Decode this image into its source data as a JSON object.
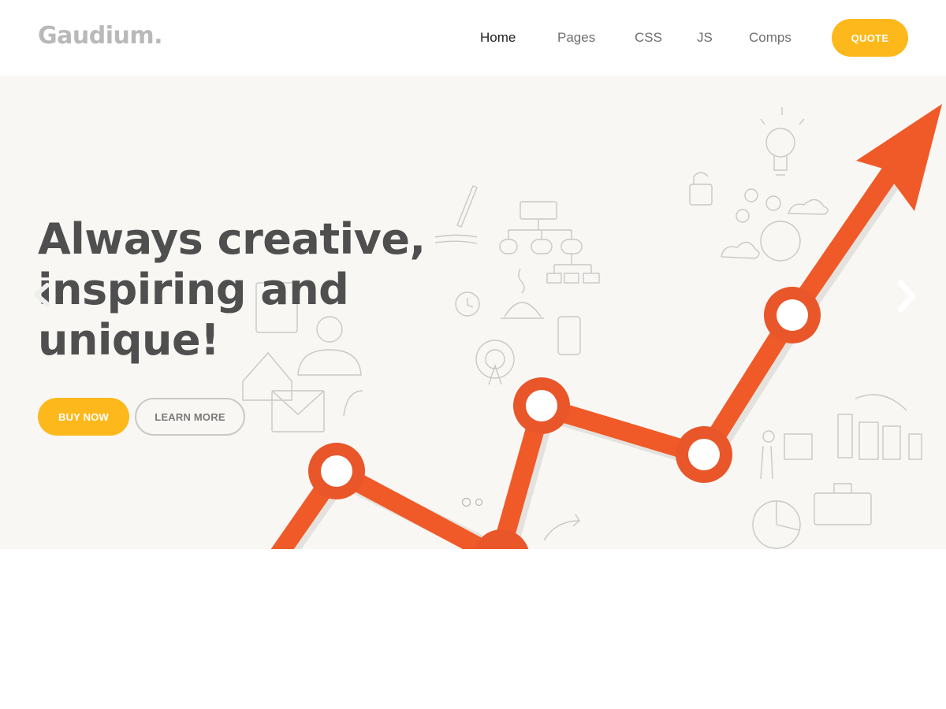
{
  "header": {
    "logo": "Gaudium.",
    "nav": [
      {
        "label": "Home",
        "active": true
      },
      {
        "label": "Pages",
        "active": false
      },
      {
        "label": "CSS",
        "active": false
      },
      {
        "label": "JS",
        "active": false
      },
      {
        "label": "Comps",
        "active": false
      }
    ],
    "quote_label": "QUOTE"
  },
  "hero": {
    "headline_lines": [
      "Always creative,",
      "inspiring and",
      "unique!"
    ],
    "buy_label": "BUY NOW",
    "learn_label": "LEARN MORE",
    "slides_count": 2,
    "active_slide": 1
  },
  "colors": {
    "accent_yellow": "#fdb81b",
    "graph_orange": "#f05a28",
    "heading_gray": "#4f4f4f",
    "hero_bg": "#f8f7f4"
  },
  "icons": [
    "chevron-left-icon",
    "chevron-right-icon"
  ]
}
